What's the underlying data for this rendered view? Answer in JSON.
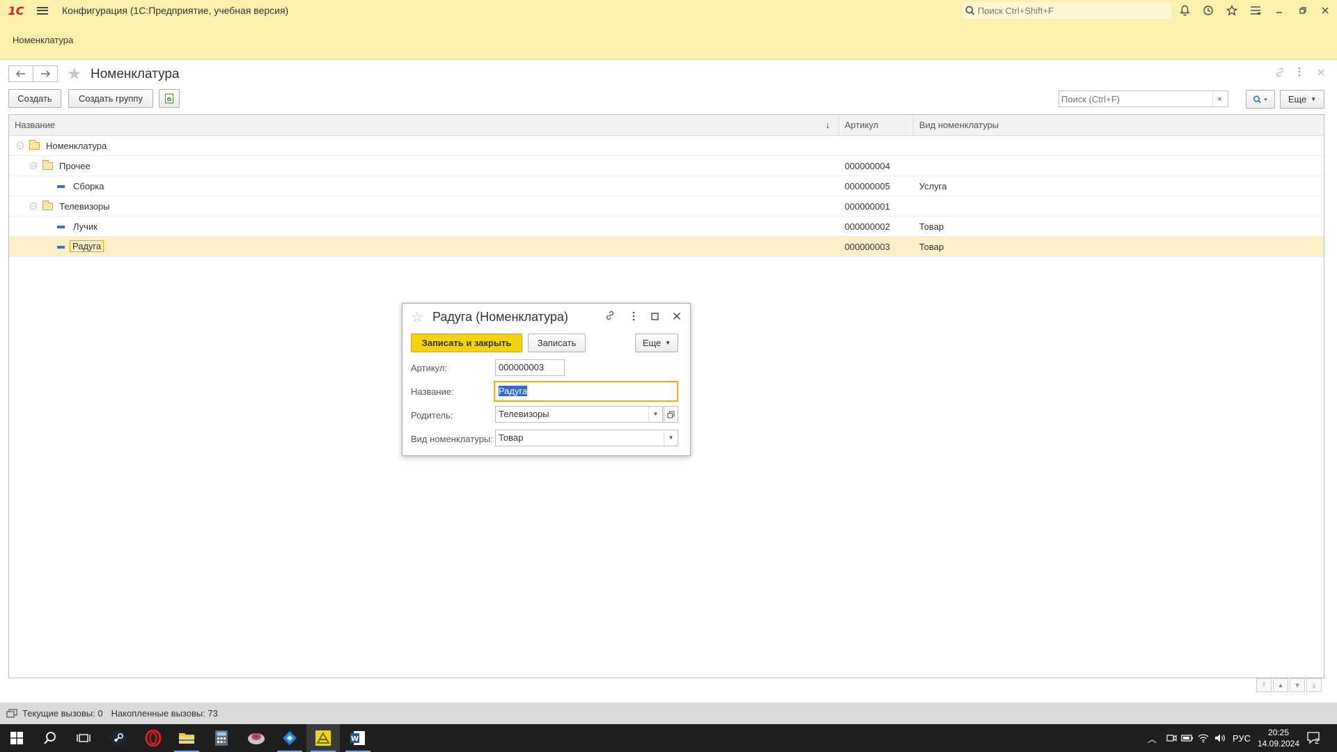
{
  "titlebar": {
    "logo": "1С",
    "app_title": "Конфигурация  (1С:Предприятие, учебная версия)",
    "search_placeholder": "Поиск Ctrl+Shift+F"
  },
  "section": {
    "title": "Номенклатура"
  },
  "form": {
    "title": "Номенклатура",
    "toolbar": {
      "create": "Создать",
      "create_group": "Создать группу",
      "search_placeholder": "Поиск (Ctrl+F)",
      "clear": "×",
      "more": "Еще"
    },
    "columns": [
      "Название",
      "Артикул",
      "Вид номенклатуры"
    ],
    "sort_indicator": "↓",
    "rows": [
      {
        "name": "Номенклатура",
        "article": "",
        "kind": "",
        "level": 0,
        "type": "folder"
      },
      {
        "name": "Прочее",
        "article": "000000004",
        "kind": "",
        "level": 1,
        "type": "folder"
      },
      {
        "name": "Сборка",
        "article": "000000005",
        "kind": "Услуга",
        "level": 2,
        "type": "item"
      },
      {
        "name": "Телевизоры",
        "article": "000000001",
        "kind": "",
        "level": 1,
        "type": "folder"
      },
      {
        "name": "Лучик",
        "article": "000000002",
        "kind": "Товар",
        "level": 2,
        "type": "item"
      },
      {
        "name": "Радуга",
        "article": "000000003",
        "kind": "Товар",
        "level": 2,
        "type": "item",
        "selected": true
      }
    ]
  },
  "dialog": {
    "title": "Радуга (Номенклатура)",
    "save_close": "Записать и закрыть",
    "save": "Записать",
    "more": "Еще",
    "fields": {
      "article_label": "Артикул:",
      "article_value": "000000003",
      "name_label": "Название:",
      "name_value": "Радуга",
      "parent_label": "Родитель:",
      "parent_value": "Телевизоры",
      "kind_label": "Вид номенклатуры:",
      "kind_value": "Товар"
    }
  },
  "statusbar": {
    "current_calls": "Текущие вызовы: 0",
    "accumulated_calls": "Накопленные вызовы: 73"
  },
  "taskbar": {
    "lang": "РУС",
    "time": "20:25",
    "date": "14.09.2024",
    "notifications": "2"
  },
  "colors": {
    "header_bg": "#fbf0ad",
    "primary_button": "#f5d20a",
    "selection": "#fbefc6"
  }
}
